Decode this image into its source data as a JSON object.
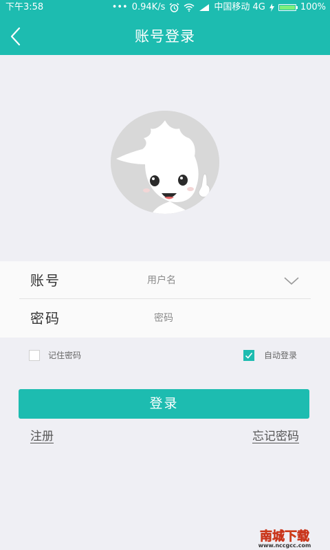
{
  "status_bar": {
    "time": "下午3:58",
    "dots": "•••",
    "speed": "0.94K/s",
    "carrier": "中国移动 4G",
    "battery_percent": "100%",
    "battery_level": 1.0,
    "icons": [
      "alarm-icon",
      "wifi-icon",
      "signal-icon",
      "charging-icon",
      "battery-icon"
    ]
  },
  "header": {
    "title": "账号登录",
    "back_icon": "back-arrow-icon",
    "color": "#1dbcb0"
  },
  "avatar": {
    "icon": "mascot-avatar"
  },
  "form": {
    "account_label": "账号",
    "account_placeholder": "用户名",
    "account_value": "",
    "password_label": "密码",
    "password_placeholder": "密码",
    "password_value": "",
    "dropdown_icon": "chevron-down-icon"
  },
  "options": {
    "remember_label": "记住密码",
    "remember_checked": false,
    "auto_login_label": "自动登录",
    "auto_login_checked": true
  },
  "actions": {
    "login_label": "登录",
    "register_label": "注册",
    "forgot_label": "忘记密码"
  },
  "watermark": {
    "text": "南城下载",
    "url": "www.nccgcc.com"
  }
}
